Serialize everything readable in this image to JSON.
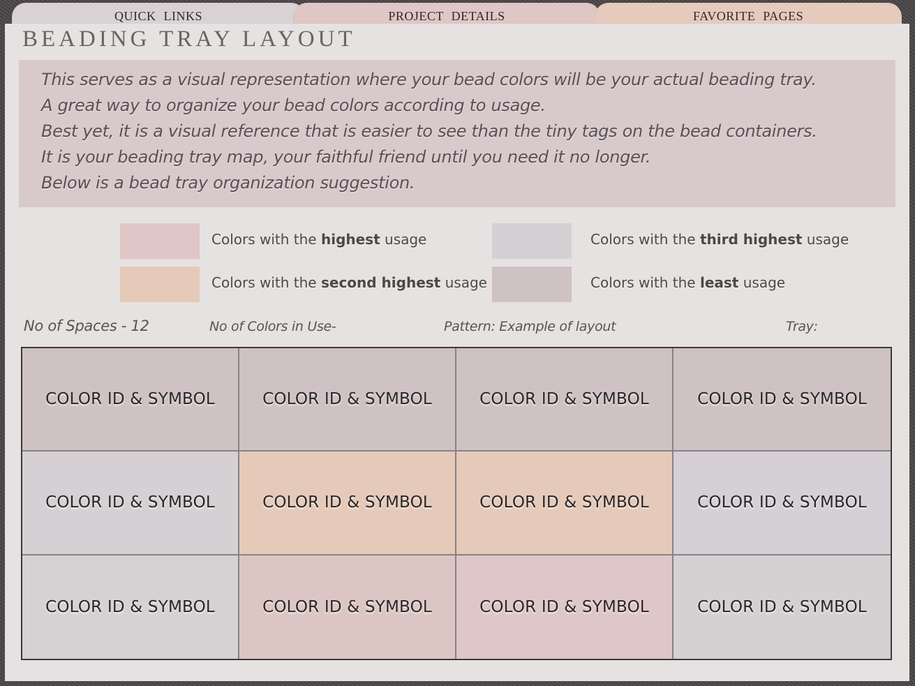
{
  "tabs": [
    {
      "label": "QUICK LINKS"
    },
    {
      "label": "PROJECT DETAILS"
    },
    {
      "label": "FAVORITE PAGES"
    }
  ],
  "page_title": "BEADING TRAY LAYOUT",
  "intro_lines": [
    "This serves as a visual representation where your bead colors will be your actual beading tray.",
    "A great way to organize your bead colors according to usage.",
    "Best yet, it is a visual reference that is easier to see than the tiny tags on the bead containers.",
    "It is your beading tray map, your faithful friend until you need it no longer.",
    "Below is a bead tray organization suggestion."
  ],
  "legend": [
    {
      "prefix": "Colors with the ",
      "bold": "highest",
      "suffix": " usage",
      "color": "#e0c6c6"
    },
    {
      "prefix": "Colors with the ",
      "bold": "second highest",
      "suffix": " usage",
      "color": "#e5cab9"
    },
    {
      "prefix": "Colors with the ",
      "bold": "third highest",
      "suffix": " usage",
      "color": "#d5d0d3"
    },
    {
      "prefix": "Colors with the ",
      "bold": "least",
      "suffix": " usage",
      "color": "#cec2c4"
    }
  ],
  "meta": {
    "spaces": "No of Spaces - 12",
    "colors_in_use": "No of Colors in Use-",
    "pattern": "Pattern: Example of layout",
    "tray": "Tray:"
  },
  "tray": {
    "cells": [
      {
        "label": "COLOR ID & SYMBOL",
        "color": "#cec2c4"
      },
      {
        "label": "COLOR ID & SYMBOL",
        "color": "#cec2c4"
      },
      {
        "label": "COLOR ID & SYMBOL",
        "color": "#cec2c4"
      },
      {
        "label": "COLOR ID & SYMBOL",
        "color": "#cec2c4"
      },
      {
        "label": "COLOR ID & SYMBOL",
        "color": "#d5d0d3"
      },
      {
        "label": "COLOR ID & SYMBOL",
        "color": "#e5cab9"
      },
      {
        "label": "COLOR ID & SYMBOL",
        "color": "#e5cab9"
      },
      {
        "label": "COLOR ID & SYMBOL",
        "color": "#d5d0d6"
      },
      {
        "label": "COLOR ID & SYMBOL",
        "color": "#d5d2d3"
      },
      {
        "label": "COLOR ID & SYMBOL",
        "color": "#dcc6c3"
      },
      {
        "label": "COLOR ID & SYMBOL",
        "color": "#dfc6c8"
      },
      {
        "label": "COLOR ID & SYMBOL",
        "color": "#d4d1d3"
      }
    ]
  }
}
